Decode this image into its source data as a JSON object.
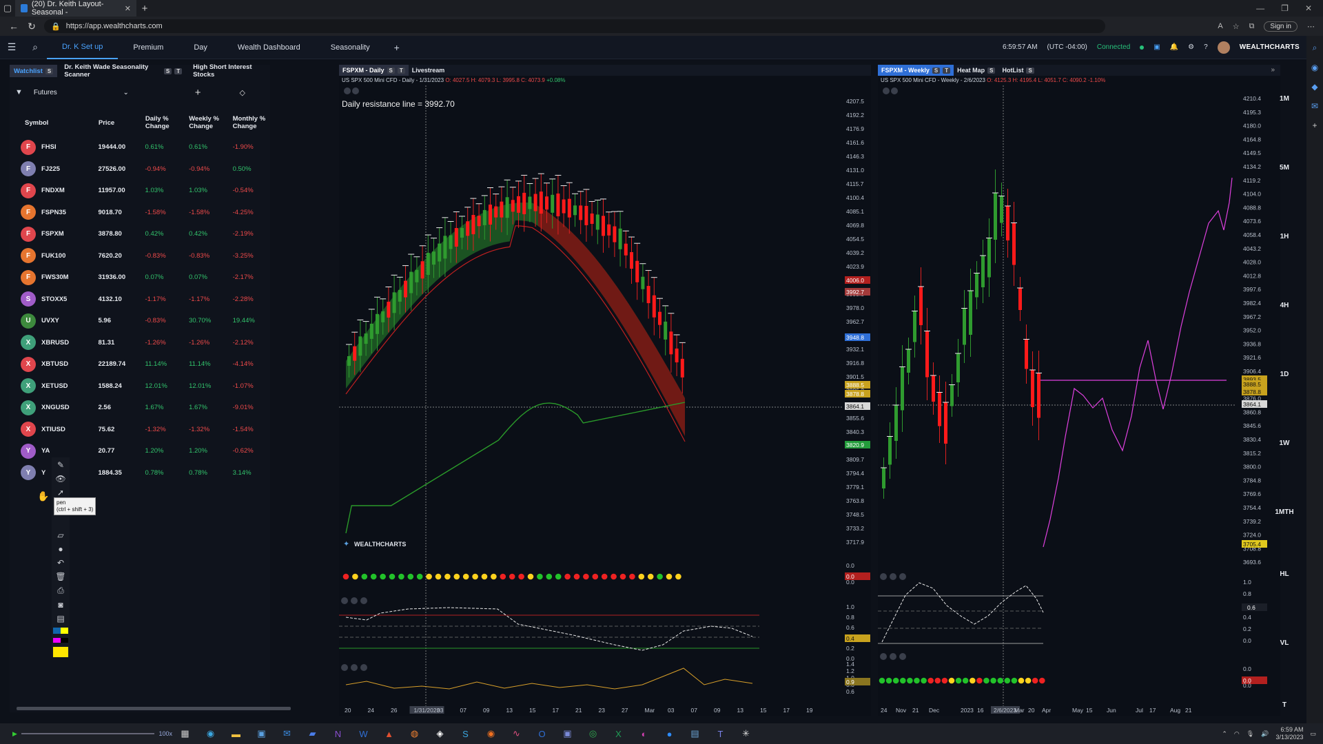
{
  "browser": {
    "tab_title": "(20) Dr. Keith Layout-Seasonal -",
    "url": "https://app.wealthcharts.com",
    "signin": "Sign in"
  },
  "appbar": {
    "tabs": [
      "Dr. K Set up",
      "Premium",
      "Day",
      "Wealth Dashboard",
      "Seasonality"
    ],
    "time": "6:59:57 AM",
    "tz": "(UTC -04:00)",
    "status": "Connected",
    "brand": "WEALTHCHARTS"
  },
  "leftpanel": {
    "tabs": [
      {
        "label": "Watchlist",
        "badge": "S"
      },
      {
        "label": "Dr. Keith Wade Seasonality Scanner",
        "badge": "S"
      },
      {
        "label": "High Short Interest Stocks",
        "badge": ""
      }
    ],
    "filter": "Futures",
    "headers": {
      "symbol": "Symbol",
      "price": "Price",
      "daily": "Daily % Change",
      "weekly": "Weekly % Change",
      "monthly": "Monthly % Change"
    },
    "rows": [
      {
        "letter": "F",
        "color": "#e0464d",
        "sym": "FHSI",
        "price": "19444.00",
        "d": "0.61%",
        "w": "0.61%",
        "m": "-1.90%"
      },
      {
        "letter": "F",
        "color": "#7f7fb0",
        "sym": "FJ225",
        "price": "27526.00",
        "d": "-0.94%",
        "w": "-0.94%",
        "m": "0.50%"
      },
      {
        "letter": "F",
        "color": "#e0464d",
        "sym": "FNDXM",
        "price": "11957.00",
        "d": "1.03%",
        "w": "1.03%",
        "m": "-0.54%"
      },
      {
        "letter": "F",
        "color": "#e6752f",
        "sym": "FSPN35",
        "price": "9018.70",
        "d": "-1.58%",
        "w": "-1.58%",
        "m": "-4.25%"
      },
      {
        "letter": "F",
        "color": "#e0464d",
        "sym": "FSPXM",
        "price": "3878.80",
        "d": "0.42%",
        "w": "0.42%",
        "m": "-2.19%"
      },
      {
        "letter": "F",
        "color": "#e6752f",
        "sym": "FUK100",
        "price": "7620.20",
        "d": "-0.83%",
        "w": "-0.83%",
        "m": "-3.25%"
      },
      {
        "letter": "F",
        "color": "#e6752f",
        "sym": "FWS30M",
        "price": "31936.00",
        "d": "0.07%",
        "w": "0.07%",
        "m": "-2.17%"
      },
      {
        "letter": "S",
        "color": "#a05cc8",
        "sym": "STOXX5",
        "price": "4132.10",
        "d": "-1.17%",
        "w": "-1.17%",
        "m": "-2.28%"
      },
      {
        "letter": "U",
        "color": "#3d8a3d",
        "sym": "UVXY",
        "price": "5.96",
        "d": "-0.83%",
        "w": "30.70%",
        "m": "19.44%"
      },
      {
        "letter": "X",
        "color": "#3fa07a",
        "sym": "XBRUSD",
        "price": "81.31",
        "d": "-1.26%",
        "w": "-1.26%",
        "m": "-2.12%"
      },
      {
        "letter": "X",
        "color": "#e0464d",
        "sym": "XBTUSD",
        "price": "22189.74",
        "d": "11.14%",
        "w": "11.14%",
        "m": "-4.14%"
      },
      {
        "letter": "X",
        "color": "#3fa07a",
        "sym": "XETUSD",
        "price": "1588.24",
        "d": "12.01%",
        "w": "12.01%",
        "m": "-1.07%"
      },
      {
        "letter": "X",
        "color": "#3fa07a",
        "sym": "XNGUSD",
        "price": "2.56",
        "d": "1.67%",
        "w": "1.67%",
        "m": "-9.01%"
      },
      {
        "letter": "X",
        "color": "#e0464d",
        "sym": "XTIUSD",
        "price": "75.62",
        "d": "-1.32%",
        "w": "-1.32%",
        "m": "-1.54%"
      },
      {
        "letter": "Y",
        "color": "#a05cc8",
        "sym": "YA",
        "price": "20.77",
        "d": "1.20%",
        "w": "1.20%",
        "m": "-0.62%"
      },
      {
        "letter": "Y",
        "color": "#7f7fb0",
        "sym": "Y",
        "price": "1884.35",
        "d": "0.78%",
        "w": "0.78%",
        "m": "3.14%"
      }
    ],
    "tooltip": {
      "name": "pen",
      "shortcut": "(ctrl + shift + 3)"
    }
  },
  "daily": {
    "tabs": [
      {
        "label": "FSPXM - Daily",
        "badge": "S"
      },
      {
        "label": "Livestream",
        "badge": ""
      }
    ],
    "ohlc_name": "US SPX 500 Mini CFD",
    "ohlc_period": "- Daily - 1/31/2023",
    "ohlc_vals": "O: 4027.5 H: 4079.3 L: 3995.8 C: 4073.9",
    "ohlc_chg": "+0.08%",
    "annotation": "Daily resistance line = 3992.70",
    "watermark": "WEALTHCHARTS",
    "price_labels": [
      "4207.5",
      "4192.2",
      "4176.9",
      "4161.6",
      "4146.3",
      "4131.0",
      "4115.7",
      "4100.4",
      "4085.1",
      "4069.8",
      "4054.5",
      "4039.2",
      "4023.9",
      "4008.6",
      "3993.3",
      "3978.0",
      "3962.7",
      "3947.4",
      "3932.1",
      "3916.8",
      "3901.5",
      "3886.2",
      "3870.9",
      "3855.6",
      "3840.3",
      "3825.0",
      "3809.7",
      "3794.4",
      "3779.1",
      "3763.8",
      "3748.5",
      "3733.2",
      "3717.9"
    ],
    "tags": [
      {
        "v": "4006.0",
        "c": "#b3201f"
      },
      {
        "v": "3992.7",
        "c": "#a33a3a"
      },
      {
        "v": "3948.8",
        "c": "#2f6fd6"
      },
      {
        "v": "3888.5",
        "c": "#c8a21e"
      },
      {
        "v": "3878.8",
        "c": "#c8a21e"
      },
      {
        "v": "3864.1",
        "c": "#d8d8d8"
      },
      {
        "v": "3820.9",
        "c": "#239c3b"
      }
    ],
    "dates": [
      "20",
      "24",
      "26",
      "1/31/2023",
      "03",
      "07",
      "09",
      "13",
      "15",
      "17",
      "21",
      "23",
      "27",
      "Mar",
      "03",
      "07",
      "09",
      "13",
      "15",
      "17",
      "19"
    ],
    "ind_vals": {
      "a": [
        "0.0",
        "0.0"
      ],
      "b": [
        "1.0",
        "0.8",
        "0.6",
        "0.4",
        "0.2",
        "0.0"
      ],
      "c": [
        "1.4",
        "1.2",
        "1.0",
        "0.8",
        "0.6"
      ]
    },
    "ind_tags": {
      "a": "0.0",
      "b": "0.4",
      "c": "0.9"
    }
  },
  "weekly": {
    "tabs": [
      {
        "label": "FSPXM - Weekly",
        "badge": "S"
      },
      {
        "label": "Heat Map",
        "badge": "S"
      },
      {
        "label": "HotList",
        "badge": "S"
      }
    ],
    "ohlc_name": "US SPX 500 Mini CFD",
    "ohlc_period": "- Weekly - 2/6/2023",
    "ohlc_vals": "O: 4125.3 H: 4195.4 L: 4051.7 C: 4090.2",
    "ohlc_chg": "-1.10%",
    "price_labels": [
      "4210.4",
      "4195.3",
      "4180.0",
      "4164.8",
      "4149.5",
      "4134.2",
      "4119.2",
      "4104.0",
      "4088.8",
      "4073.6",
      "4058.4",
      "4043.2",
      "4028.0",
      "4012.8",
      "3997.6",
      "3982.4",
      "3967.2",
      "3952.0",
      "3936.8",
      "3921.6",
      "3906.4",
      "3891.2",
      "3876.0",
      "3860.8",
      "3845.6",
      "3830.4",
      "3815.2",
      "3800.0",
      "3784.8",
      "3769.6",
      "3754.4",
      "3739.2",
      "3724.0",
      "3708.8",
      "3693.6"
    ],
    "tags": [
      {
        "v": "3893.5",
        "c": "#c8a21e"
      },
      {
        "v": "3888.5",
        "c": "#c8a21e"
      },
      {
        "v": "3878.8",
        "c": "#c8a21e"
      },
      {
        "v": "3864.1",
        "c": "#d8d8d8"
      },
      {
        "v": "3705.4",
        "c": "#e0c81e"
      }
    ],
    "dates": [
      "24",
      "Nov",
      "21",
      "Dec",
      "2023",
      "16",
      "2/6/2023",
      "Mar",
      "20",
      "Apr",
      "May",
      "15",
      "Jun",
      "Jul",
      "17",
      "Aug",
      "21"
    ],
    "ind_vals": {
      "a": [
        "1.0",
        "0.8",
        "0.6",
        "0.4",
        "0.2",
        "0.0"
      ],
      "b": [
        "0.0",
        "0.0"
      ]
    },
    "ind_tags": {
      "a": "0.6",
      "b": "0.0"
    }
  },
  "timeframes": [
    "1M",
    "5M",
    "1H",
    "4H",
    "1D",
    "1W",
    "1MTH",
    "HL",
    "VL",
    "T"
  ],
  "taskbar": {
    "zoom": "100x",
    "time": "6:59 AM",
    "date": "3/13/2023"
  }
}
